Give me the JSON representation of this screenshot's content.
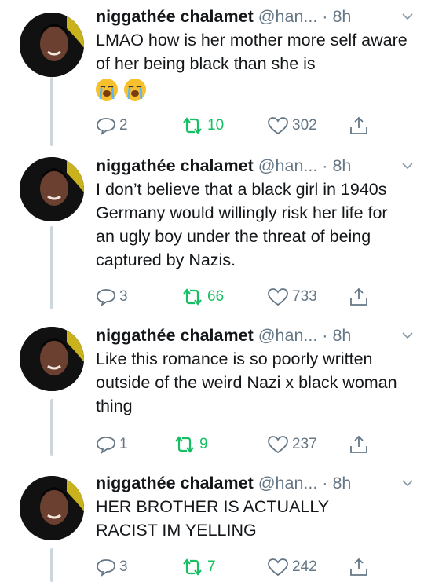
{
  "tweets": [
    {
      "name": "niggathée chalamet",
      "handle": "@han... · 8h",
      "text": "LMAO how is her mother more self aware of her being black than she is",
      "emojis": [
        "loudly-crying-face",
        "loudly-crying-face"
      ],
      "replies": "2",
      "retweets": "10",
      "likes": "302"
    },
    {
      "name": "niggathée chalamet",
      "handle": "@han... · 8h",
      "text": "I don’t believe that a black girl in 1940s Germany would willingly risk her life for an ugly boy under the threat of being captured by Nazis.",
      "replies": "3",
      "retweets": "66",
      "likes": "733"
    },
    {
      "name": "niggathée chalamet",
      "handle": "@han... · 8h",
      "text": "Like this romance is so poorly written outside of the weird Nazi x black woman thing",
      "replies": "1",
      "retweets": "9",
      "likes": "237"
    },
    {
      "name": "niggathée chalamet",
      "handle": "@han... · 8h",
      "text": "HER BROTHER IS ACTUALLY RACIST IM YELLING",
      "replies": "3",
      "retweets": "7",
      "likes": "242"
    }
  ],
  "icons": {
    "reply": "reply-icon",
    "retweet": "retweet-icon",
    "like": "heart-icon",
    "share": "share-icon",
    "caret": "chevron-down-icon"
  },
  "colors": {
    "text": "#14171a",
    "muted": "#657786",
    "retweet": "#17bf63",
    "thread_line": "#ccd6dd",
    "avatar_accent": "#c9b21c"
  }
}
